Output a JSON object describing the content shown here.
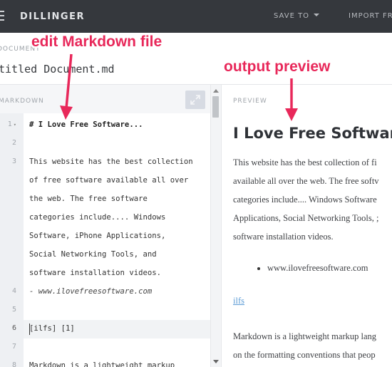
{
  "app": {
    "brand": "DILLINGER",
    "save_to": "SAVE TO",
    "import_from": "IMPORT FR"
  },
  "document": {
    "label": "DOCUMENT",
    "name": "titled Document.md"
  },
  "editor": {
    "header": "MARKDOWN",
    "lines": [
      {
        "num": "1",
        "text": "# I Love Free Software...",
        "style": "bold",
        "folded": true
      },
      {
        "num": "2",
        "text": "",
        "style": "normal"
      },
      {
        "num": "3",
        "text": "This website has the best collection",
        "style": "normal"
      },
      {
        "num": "",
        "text": "of free software available all over",
        "style": "normal"
      },
      {
        "num": "",
        "text": "the web. The free software",
        "style": "normal"
      },
      {
        "num": "",
        "text": "categories include.... Windows",
        "style": "normal"
      },
      {
        "num": "",
        "text": "Software, iPhone Applications,",
        "style": "normal"
      },
      {
        "num": "",
        "text": "Social Networking Tools, and",
        "style": "normal"
      },
      {
        "num": "",
        "text": "software installation videos.",
        "style": "normal"
      },
      {
        "num": "4",
        "text": "- www.ilovefreesoftware.com",
        "style": "italic"
      },
      {
        "num": "5",
        "text": "",
        "style": "normal"
      },
      {
        "num": "6",
        "text": "[ilfs] [1]",
        "style": "normal",
        "active": true
      },
      {
        "num": "7",
        "text": "",
        "style": "normal"
      },
      {
        "num": "8",
        "text": "Markdown is a lightweight markup",
        "style": "normal"
      }
    ]
  },
  "preview": {
    "header": "PREVIEW",
    "title": "I Love Free Software",
    "paragraph_lines": [
      "This website has the best collection of fi",
      "available all over the web. The free softv",
      "categories include.... Windows Software",
      "Applications, Social Networking Tools, ;",
      "software installation videos."
    ],
    "list_item": "www.ilovefreesoftware.com",
    "link": "ilfs",
    "paragraph2_lines": [
      "Markdown is a lightweight markup lang",
      "on the formatting conventions that peop"
    ]
  },
  "annotations": {
    "edit": "edit Markdown file",
    "output": "output preview",
    "color": "#e8285a"
  },
  "colors": {
    "topbar": "#35383d",
    "link": "#5b9bd5"
  }
}
